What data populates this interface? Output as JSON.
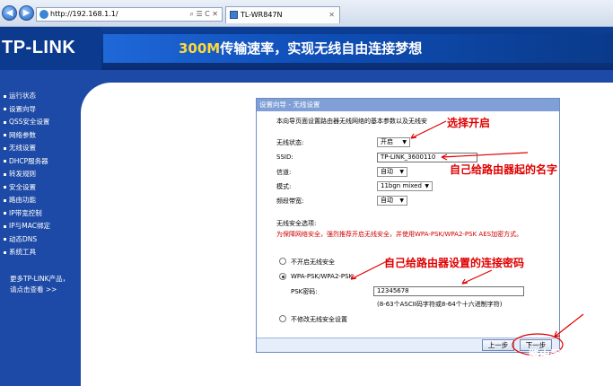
{
  "browser": {
    "address": "http://192.168.1.1/",
    "address_tools": "⌕ ☰ C ✕",
    "tab_title": "TL-WR847N",
    "tab_close": "✕"
  },
  "banner": {
    "logo": "TP-LINK",
    "slogan_accent": "300M",
    "slogan_rest": "传输速率，实现无线自由连接梦想"
  },
  "menu": {
    "items": [
      "运行状态",
      "设置向导",
      "QSS安全设置",
      "网络参数",
      "无线设置",
      "DHCP服务器",
      "转发规则",
      "安全设置",
      "路由功能",
      "IP带宽控制",
      "IP与MAC绑定",
      "动态DNS",
      "系统工具"
    ],
    "more_line1": "更多TP-LINK产品，",
    "more_line2": "请点击查看 >>"
  },
  "dialog": {
    "title": "设置向导 - 无线设置",
    "intro": "本向导页面设置路由器无线网络的基本参数以及无线安",
    "wireless_status_label": "无线状态:",
    "wireless_status_value": "开启",
    "ssid_label": "SSID:",
    "ssid_value": "TP-LINK_3600110",
    "channel_label": "信道:",
    "channel_value": "自动",
    "mode_label": "模式:",
    "mode_value": "11bgn mixed",
    "bandwidth_label": "频段带宽:",
    "bandwidth_value": "自动",
    "security_heading": "无线安全选项:",
    "security_warning": "为保障网络安全，强烈推荐开启无线安全，并使用WPA-PSK/WPA2-PSK AES加密方式。",
    "opt_none": "不开启无线安全",
    "opt_wpa": "WPA-PSK/WPA2-PSK",
    "psk_label": "PSK密码:",
    "psk_value": "12345678",
    "psk_hint": "(8-63个ASCII码字符或8-64个十六进制字符)",
    "opt_keep": "不修改无线安全设置",
    "prev_button": "上一步",
    "next_button": "下一步"
  },
  "annotations": {
    "enable": "选择开启",
    "name": "自己给路由器起的名字",
    "password": "自己给路由器设置的连接密码"
  },
  "watermark": {
    "name": "路由器之家",
    "url": "luyouqi520.com"
  },
  "colors": {
    "page_blue": "#1d4aa6",
    "annotation_red": "#e00000",
    "slogan_accent": "#ffd83a",
    "dialog_title_bg": "#7f9fd6"
  }
}
